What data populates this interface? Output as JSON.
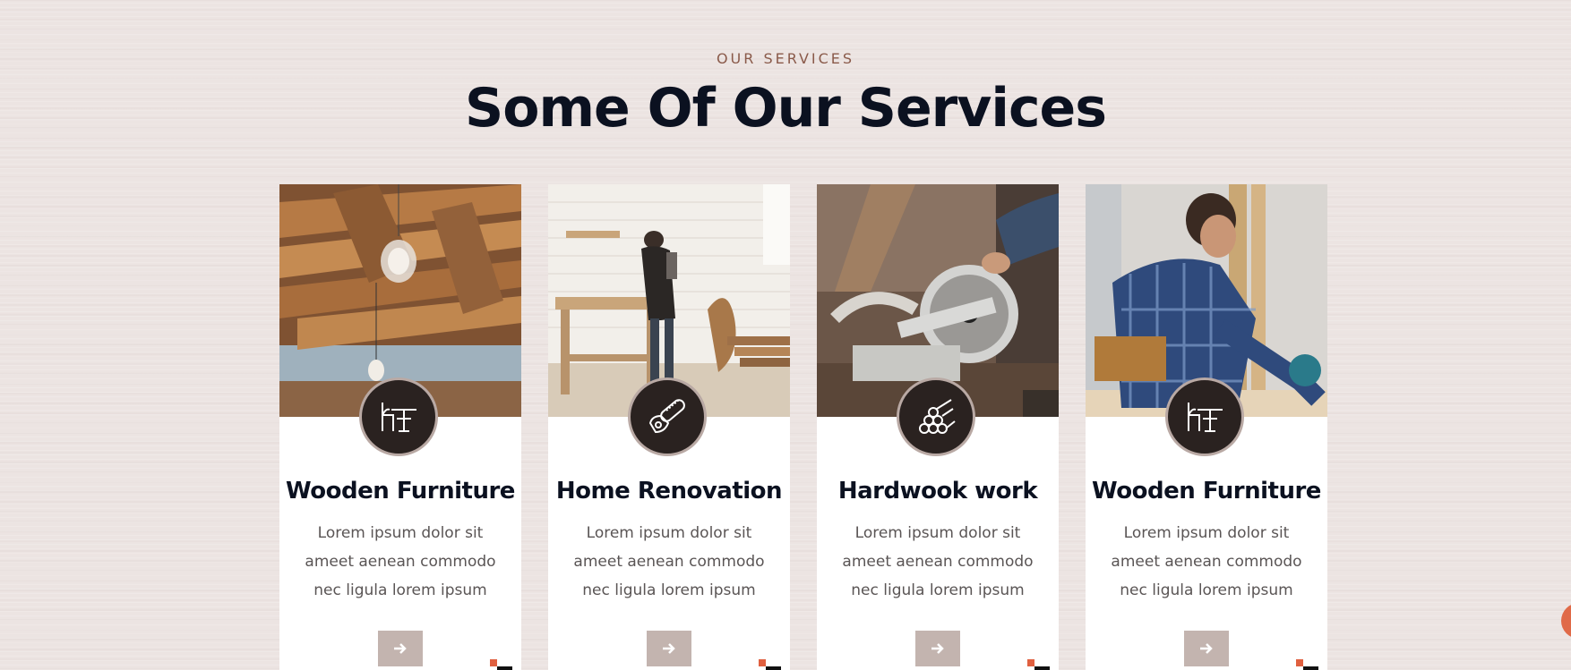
{
  "section": {
    "label": "OUR SERVICES",
    "title": "Some Of Our Services"
  },
  "cards": [
    {
      "title": "Wooden Furniture",
      "text": "Lorem ipsum dolor sit ameet aenean commodo nec ligula lorem ipsum",
      "icon": "table-chair-icon",
      "image": "wooden-ceiling-beams-photo"
    },
    {
      "title": "Home Renovation",
      "text": "Lorem ipsum dolor sit ameet aenean commodo nec ligula lorem ipsum",
      "icon": "chainsaw-icon",
      "image": "carpenter-workbench-photo"
    },
    {
      "title": "Hardwook work",
      "text": "Lorem ipsum dolor sit ameet aenean commodo nec ligula lorem ipsum",
      "icon": "wood-logs-icon",
      "image": "miter-saw-photo"
    },
    {
      "title": "Wooden Furniture",
      "text": "Lorem ipsum dolor sit ameet aenean commodo nec ligula lorem ipsum",
      "icon": "table-chair-icon",
      "image": "carpenter-cutting-photo"
    }
  ],
  "button_icon": "arrow-right-icon",
  "colors": {
    "accent": "#e06040",
    "title": "#0b1120",
    "label": "#8a5a4a",
    "button": "#c3b4af",
    "icon_circle": "#2a2220"
  }
}
